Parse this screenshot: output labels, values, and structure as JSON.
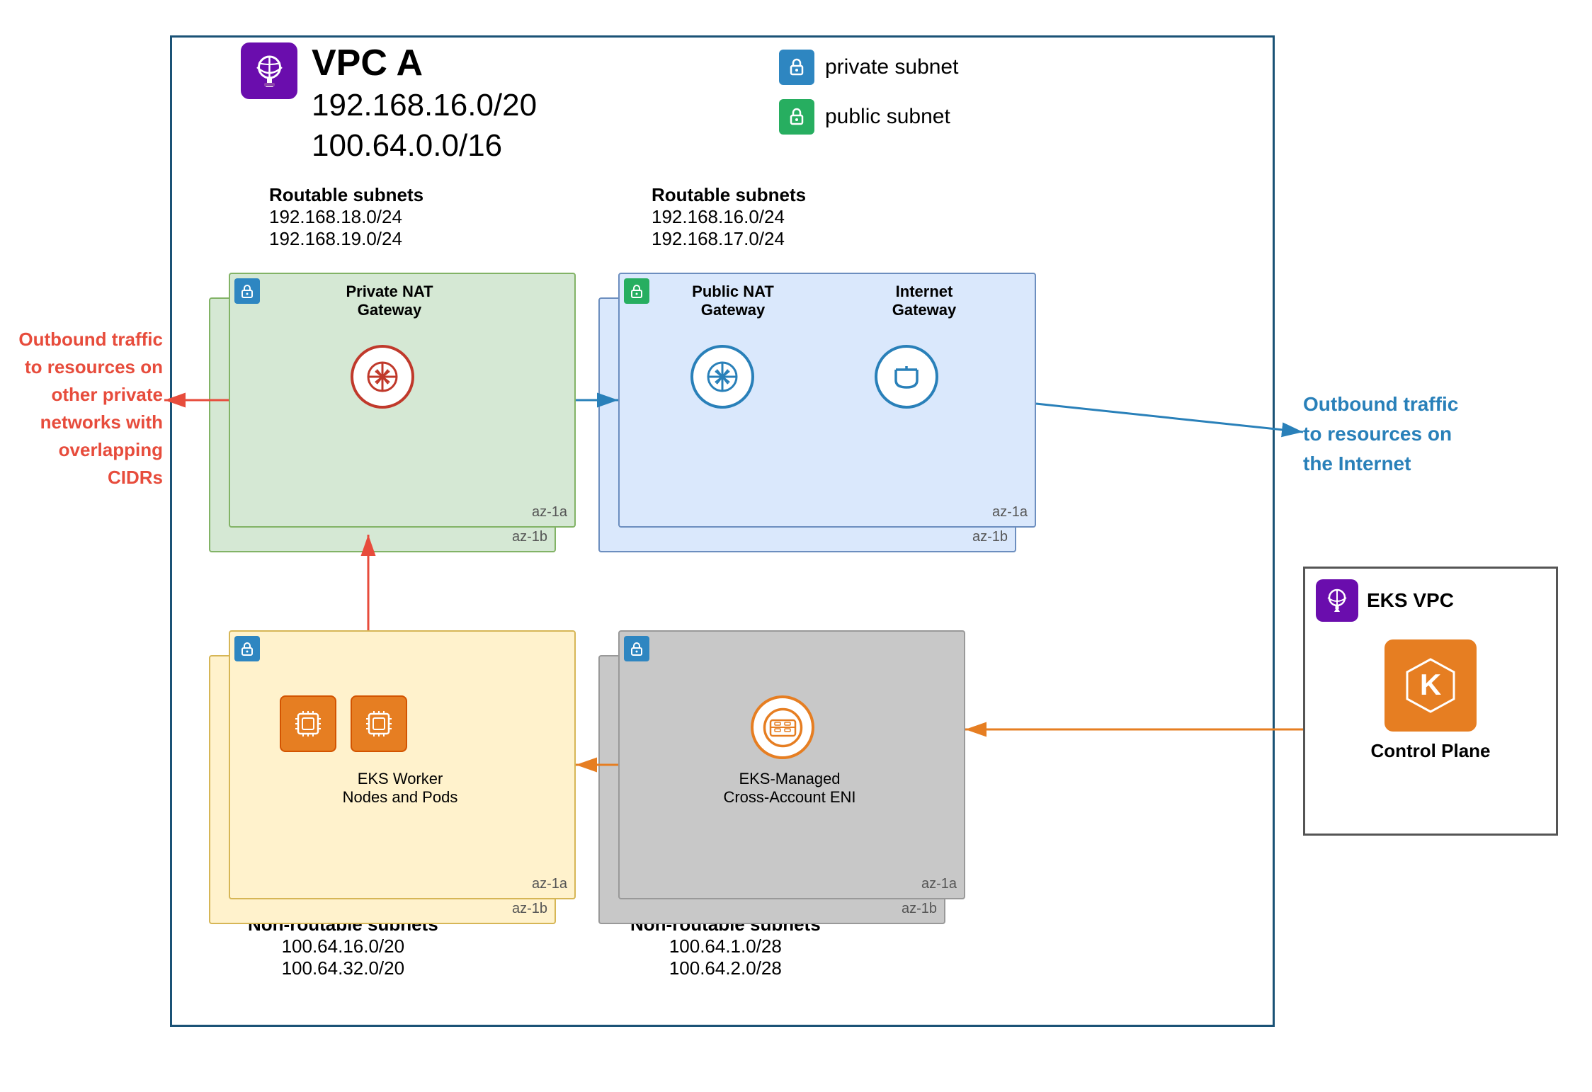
{
  "vpc_a": {
    "title": "VPC A",
    "cidr1": "192.168.16.0/20",
    "cidr2": "100.64.0.0/16"
  },
  "legend": {
    "private_subnet": "private subnet",
    "public_subnet": "public subnet"
  },
  "routable_left": {
    "label": "Routable subnets",
    "cidr1": "192.168.18.0/24",
    "cidr2": "192.168.19.0/24"
  },
  "routable_right": {
    "label": "Routable subnets",
    "cidr1": "192.168.16.0/24",
    "cidr2": "192.168.17.0/24"
  },
  "nonroutable_left": {
    "label": "Non-routable subnets",
    "cidr1": "100.64.16.0/20",
    "cidr2": "100.64.32.0/20"
  },
  "nonroutable_right": {
    "label": "Non-routable subnets",
    "cidr1": "100.64.1.0/28",
    "cidr2": "100.64.2.0/28"
  },
  "private_nat": {
    "label": "Private NAT\nGateway",
    "az_inner": "az-1a",
    "az_outer": "az-1b"
  },
  "public_nat": {
    "label": "Public NAT\nGateway",
    "az_inner": "az-1a",
    "az_outer": "az-1b"
  },
  "internet_gw": {
    "label": "Internet\nGateway",
    "az_inner": "az-1a",
    "az_outer": "az-1b"
  },
  "eks_workers": {
    "label": "EKS Worker\nNodes and Pods",
    "az_inner": "az-1a",
    "az_outer": "az-1b"
  },
  "eks_eni": {
    "label": "EKS-Managed\nCross-Account ENI",
    "az_inner": "az-1a",
    "az_outer": "az-1b"
  },
  "eks_vpc": {
    "title": "EKS VPC",
    "label": "Control Plane"
  },
  "outbound_left": {
    "text": "Outbound traffic\nto resources on\nother private\nnetworks with\noverlapping CIDRs"
  },
  "outbound_right": {
    "text": "Outbound traffic\nto resources on\nthe Internet"
  },
  "colors": {
    "purple": "#6a0dad",
    "blue_dark": "#1a5276",
    "blue_mid": "#2980b9",
    "green": "#27ae60",
    "red": "#c0392b",
    "orange": "#e67e22",
    "subnet_blue": "#2e86c1",
    "subnet_green": "#27ae60"
  }
}
